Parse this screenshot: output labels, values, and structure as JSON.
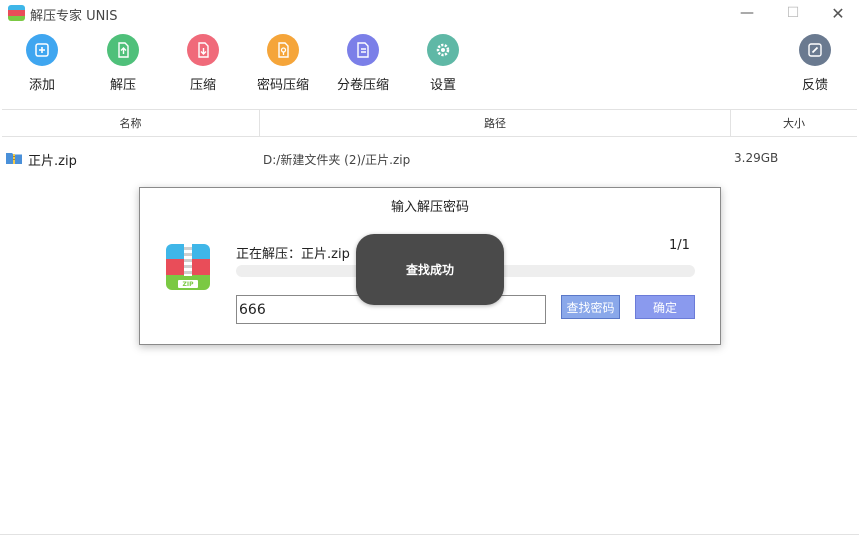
{
  "window": {
    "title": "解压专家 UNIS",
    "min_glyph": "—",
    "max_glyph": "☐",
    "close_glyph": "✕"
  },
  "toolbar": {
    "items": [
      {
        "label": "添加",
        "icon": "plus-icon",
        "color": "#3fa6f0"
      },
      {
        "label": "解压",
        "icon": "extract-icon",
        "color": "#4fc07a"
      },
      {
        "label": "压缩",
        "icon": "compress-icon",
        "color": "#f06a7a"
      },
      {
        "label": "密码压缩",
        "icon": "password-compress-icon",
        "color": "#f5a53a"
      },
      {
        "label": "分卷压缩",
        "icon": "split-compress-icon",
        "color": "#7b7fe8"
      },
      {
        "label": "设置",
        "icon": "gear-icon",
        "color": "#5fb8a6"
      }
    ],
    "feedback": {
      "label": "反馈",
      "icon": "edit-icon",
      "color": "#6a7a90"
    }
  },
  "table": {
    "headers": {
      "name": "名称",
      "path": "路径",
      "size": "大小"
    },
    "rows": [
      {
        "name": "正片.zip",
        "path": "D:/新建文件夹 (2)/正片.zip",
        "size": "3.29GB"
      }
    ]
  },
  "dialog": {
    "title": "输入解压密码",
    "progress_label": "正在解压：正片.zip",
    "progress_count": "1/1",
    "progress": 0,
    "password_value": "666",
    "find_button": "查找密码",
    "ok_button": "确定",
    "zip_icon_label": "ZIP"
  },
  "toast": {
    "message": "查找成功"
  }
}
